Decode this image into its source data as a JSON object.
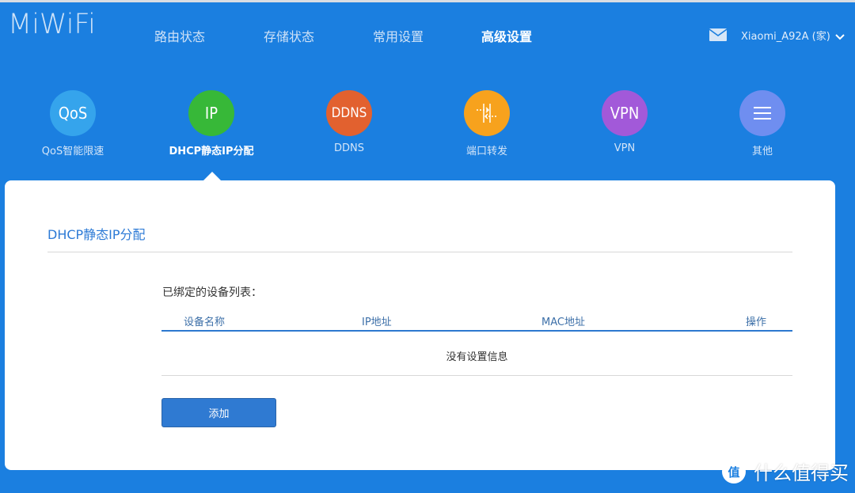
{
  "app": {
    "logo": "MiWiFi"
  },
  "nav": {
    "items": [
      {
        "label": "路由状态",
        "active": false
      },
      {
        "label": "存储状态",
        "active": false
      },
      {
        "label": "常用设置",
        "active": false
      },
      {
        "label": "高级设置",
        "active": true
      }
    ]
  },
  "header": {
    "user_label": "Xiaomi_A92A (家)",
    "mail_icon": "mail-icon",
    "dropdown_icon": "chevron-down-icon"
  },
  "tools": [
    {
      "icon_text": "QoS",
      "label": "QoS智能限速",
      "color": "#35a4ec",
      "active": false
    },
    {
      "icon_text": "IP",
      "label": "DHCP静态IP分配",
      "color": "#37b838",
      "active": true
    },
    {
      "icon_text": "DDNS",
      "label": "DDNS",
      "color": "#e2612f",
      "active": false
    },
    {
      "icon_text": "",
      "icon": "port-forward-icon",
      "label": "端口转发",
      "color": "#f7a21d",
      "active": false
    },
    {
      "icon_text": "VPN",
      "label": "VPN",
      "color": "#a259d9",
      "active": false
    },
    {
      "icon_text": "",
      "icon": "menu-icon",
      "label": "其他",
      "color": "#6f8ef0",
      "active": false
    }
  ],
  "panel": {
    "title": "DHCP静态IP分配",
    "list_title": "已绑定的设备列表：",
    "columns": [
      "设备名称",
      "IP地址",
      "MAC地址",
      "操作"
    ],
    "empty_text": "没有设置信息",
    "add_button": "添加"
  },
  "watermark": {
    "text": "什么值得买",
    "icon": "smzdm-logo-icon"
  }
}
